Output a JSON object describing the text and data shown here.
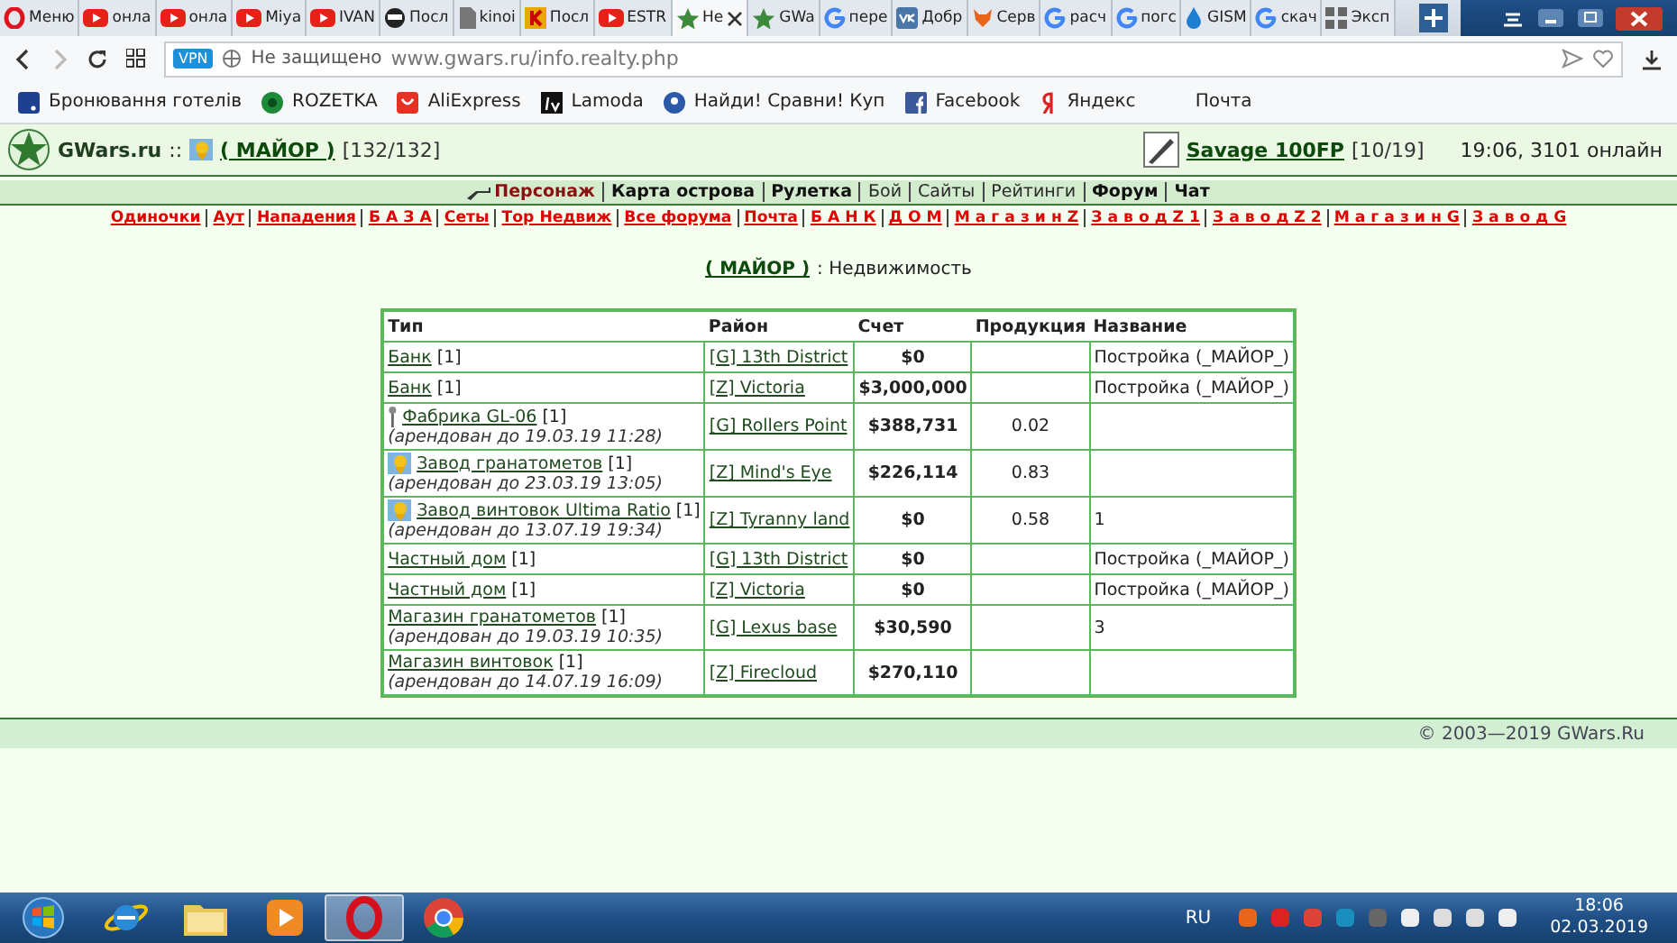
{
  "browser": {
    "tabs": [
      {
        "label": "Меню",
        "selected": false
      },
      {
        "label": "онла",
        "selected": false
      },
      {
        "label": "онла",
        "selected": false
      },
      {
        "label": "Miya",
        "selected": false
      },
      {
        "label": "IVAN",
        "selected": false
      },
      {
        "label": "Посл",
        "selected": false
      },
      {
        "label": "kinoi",
        "selected": false
      },
      {
        "label": "Посл",
        "selected": false
      },
      {
        "label": "ESTR",
        "selected": false
      },
      {
        "label": "Не",
        "selected": true
      },
      {
        "label": "GWa",
        "selected": false
      },
      {
        "label": "пере",
        "selected": false
      },
      {
        "label": "Добр",
        "selected": false
      },
      {
        "label": "Серв",
        "selected": false
      },
      {
        "label": "расч",
        "selected": false
      },
      {
        "label": "погс",
        "selected": false
      },
      {
        "label": "GISM",
        "selected": false
      },
      {
        "label": "скач",
        "selected": false
      },
      {
        "label": "Эксп",
        "selected": false
      }
    ],
    "address": {
      "vpn": "VPN",
      "security": "Не защищено",
      "url": "www.gwars.ru/info.realty.php"
    },
    "bookmarks": [
      "Бронювання готелів",
      "ROZETKA",
      "AliExpress",
      "Lamoda",
      "Найди! Сравни! Куп",
      "Facebook",
      "Яндекс",
      "Почта"
    ]
  },
  "header": {
    "site": "GWars.ru",
    "separator": "::",
    "player": "( МАЙОР )",
    "hp": "[132/132]",
    "weapon": "Savage 100FP",
    "durability": "[10/19]",
    "status": "19:06, 3101 онлайн"
  },
  "main_nav": [
    {
      "label": "Персонаж",
      "bold": true,
      "current": true
    },
    {
      "label": "Карта острова",
      "bold": true,
      "current": false
    },
    {
      "label": "Рулетка",
      "bold": true,
      "current": false
    },
    {
      "label": "Бой",
      "bold": false,
      "current": false
    },
    {
      "label": "Сайты",
      "bold": false,
      "current": false
    },
    {
      "label": "Рейтинги",
      "bold": false,
      "current": false
    },
    {
      "label": "Форум",
      "bold": true,
      "current": false
    },
    {
      "label": "Чат",
      "bold": true,
      "current": false
    }
  ],
  "forum_nav": [
    "Одиночки",
    "Аут",
    "Нападения",
    "Б А З А",
    "Сеты",
    "Тор Недвиж",
    "Все форума",
    "Почта",
    "Б А Н К",
    "Д О М",
    "М а г а з и н Z",
    "З а в о д Z 1",
    "З а в о д Z 2",
    "М а г а з и н G",
    "З а в о д G"
  ],
  "heading": {
    "player": "( МАЙОР )",
    "title": ": Недвижимость"
  },
  "table": {
    "columns": [
      "Тип",
      "Район",
      "Счет",
      "Продукция",
      "Название"
    ],
    "rows": [
      {
        "type": "Банк",
        "count": "[1]",
        "kind": "plain",
        "district": "[G] 13th District",
        "account": "$0",
        "name": "Постройка (_МАЙОР_)"
      },
      {
        "type": "Банк",
        "count": "[1]",
        "kind": "plain",
        "district": "[Z] Victoria",
        "account": "$3,000,000",
        "name": "Постройка (_МАЙОР_)"
      },
      {
        "type": "Фабрика GL-06",
        "count": "[1]",
        "kind": "torch",
        "lease": "(арендован до 19.03.19 11:28)",
        "district": "[G] Rollers Point",
        "account": "$388,731",
        "production": "0.02"
      },
      {
        "type": "Завод гранатометов",
        "count": "[1]",
        "kind": "rank",
        "lease": "(арендован до 23.03.19 13:05)",
        "district": "[Z] Mind's Eye",
        "account": "$226,114",
        "production": "0.83"
      },
      {
        "type": "Завод винтовок Ultima Ratio",
        "count": "[1]",
        "kind": "rank",
        "lease": "(арендован до 13.07.19 19:34)",
        "district": "[Z] Tyranny land",
        "account": "$0",
        "production": "0.58",
        "name": "1"
      },
      {
        "type": "Частный дом",
        "count": "[1]",
        "kind": "plain",
        "district": "[G] 13th District",
        "account": "$0",
        "name": "Постройка (_МАЙОР_)"
      },
      {
        "type": "Частный дом",
        "count": "[1]",
        "kind": "plain",
        "district": "[Z] Victoria",
        "account": "$0",
        "name": "Постройка (_МАЙОР_)"
      },
      {
        "type": "Магазин гранатометов",
        "count": "[1]",
        "kind": "plain",
        "lease": "(арендован до 19.03.19 10:35)",
        "district": "[G] Lexus base",
        "account": "$30,590",
        "name": "3"
      },
      {
        "type": "Магазин винтовок",
        "count": "[1]",
        "kind": "plain",
        "lease": "(арендован до 14.07.19 16:09)",
        "district": "[Z] Firecloud",
        "account": "$270,110"
      }
    ]
  },
  "footer": "© 2003—2019 GWars.Ru",
  "taskbar": {
    "apps": [
      {
        "selected": false
      },
      {
        "selected": false
      },
      {
        "selected": false
      },
      {
        "selected": true
      },
      {
        "selected": false
      }
    ],
    "language": "RU",
    "time": "18:06",
    "date": "02.03.2019"
  }
}
